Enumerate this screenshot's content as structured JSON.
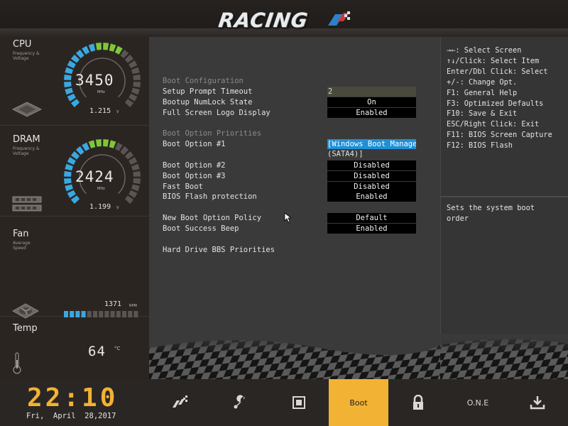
{
  "header": {
    "logo_text": "RACING"
  },
  "sidebar": {
    "cpu": {
      "title": "CPU",
      "sub1": "Frequency &",
      "sub2": "Voltage",
      "value": "3450",
      "unit": "MHz",
      "voltage": "1.215",
      "volt_unit": "V",
      "fill_fraction": 0.62
    },
    "dram": {
      "title": "DRAM",
      "sub1": "Frequency &",
      "sub2": "Voltage",
      "value": "2424",
      "unit": "MHz",
      "voltage": "1.199",
      "volt_unit": "V",
      "fill_fraction": 0.58
    },
    "fan": {
      "title": "Fan",
      "sub1": "Average",
      "sub2": "Speed",
      "rpm": "1371",
      "rpm_unit": "RPM",
      "bar_fill": 4,
      "bar_total": 13
    },
    "temp": {
      "title": "Temp",
      "value": "64",
      "unit_c": "°C"
    }
  },
  "main": {
    "rows": [
      {
        "label": "Boot Configuration",
        "header": true
      },
      {
        "label": "Setup Prompt Timeout",
        "value": "2",
        "style": "input"
      },
      {
        "label": "Bootup NumLock State",
        "value": "On"
      },
      {
        "label": "Full Screen Logo Display",
        "value": "Enabled"
      },
      {
        "label": "Boot Option Priorities",
        "header": true
      },
      {
        "label": "Boot Option #1",
        "value": "[Windows Boot Manager",
        "value_line2": "(SATA4)]",
        "style": "selected"
      },
      {
        "label": "Boot Option #2",
        "value": "Disabled"
      },
      {
        "label": "Boot Option #3",
        "value": "Disabled"
      },
      {
        "label": "Fast Boot",
        "value": "Disabled"
      },
      {
        "label": "BIOS Flash protection",
        "value": "Enabled"
      },
      {
        "label": "New Boot Option Policy",
        "value": "Default"
      },
      {
        "label": "Boot Success Beep",
        "value": "Enabled"
      },
      {
        "label": "Hard Drive BBS Priorities"
      }
    ]
  },
  "help": {
    "keys": [
      "→←: Select Screen",
      "↑↓/Click: Select Item",
      "Enter/Dbl Click: Select",
      "+/-: Change Opt.",
      "F1: General Help",
      "F3: Optimized Defaults",
      "F10: Save & Exit",
      "ESC/Right Click: Exit",
      "F11: BIOS Screen Capture",
      "F12: BIOS Flash"
    ],
    "description": "Sets the system boot order"
  },
  "bottom": {
    "clock": "22:10",
    "date": "Fri,  April  28,2017",
    "tabs": [
      {
        "name": "main",
        "label": "",
        "icon": "racing-flag-icon",
        "active": false
      },
      {
        "name": "advanced",
        "label": "",
        "icon": "wrench-icon",
        "active": false
      },
      {
        "name": "chipset",
        "label": "",
        "icon": "chip-icon",
        "active": false
      },
      {
        "name": "boot",
        "label": "Boot",
        "icon": "",
        "active": true
      },
      {
        "name": "security",
        "label": "",
        "icon": "lock-icon",
        "active": false
      },
      {
        "name": "one",
        "label": "O.N.E",
        "icon": "",
        "active": false
      },
      {
        "name": "exit",
        "label": "",
        "icon": "download-icon",
        "active": false
      }
    ]
  },
  "colors": {
    "accent": "#f2b233",
    "selection": "#1f8fd6",
    "gauge_blue": "#3aa8e0",
    "gauge_green": "#7ec63a",
    "gauge_empty": "#5a5452"
  }
}
